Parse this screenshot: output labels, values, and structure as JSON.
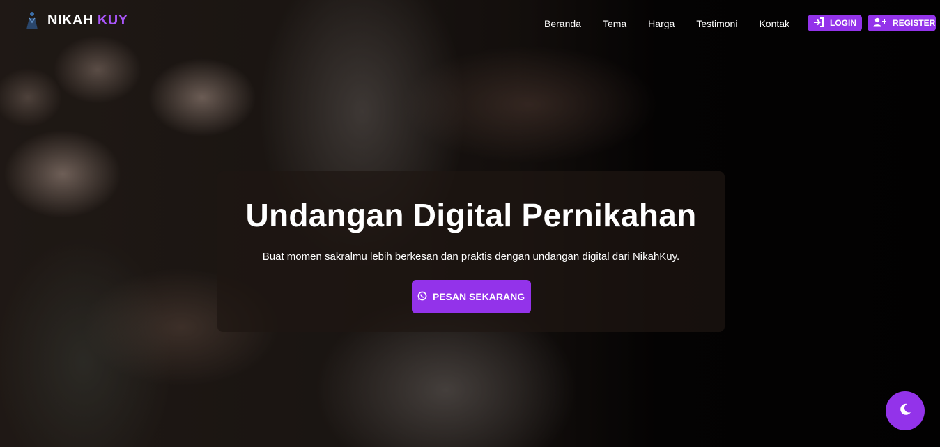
{
  "brand": {
    "name_primary": "NIKAH",
    "name_accent": "KUY",
    "accent_color": "#a855f7"
  },
  "nav": {
    "links": [
      "Beranda",
      "Tema",
      "Harga",
      "Testimoni",
      "Kontak"
    ]
  },
  "auth": {
    "login_label": "LOGIN",
    "login_icon": "sign-in-icon",
    "register_label": "REGISTER",
    "register_icon": "user-plus-icon",
    "button_color": "#9333ea"
  },
  "hero": {
    "title": "Undangan Digital Pernikahan",
    "subtitle": "Buat momen sakralmu lebih berkesan dan praktis dengan undangan digital dari NikahKuy.",
    "cta_label": "PESAN SEKARANG",
    "cta_icon": "whatsapp-icon"
  },
  "theme_toggle": {
    "icon": "moon-icon"
  }
}
